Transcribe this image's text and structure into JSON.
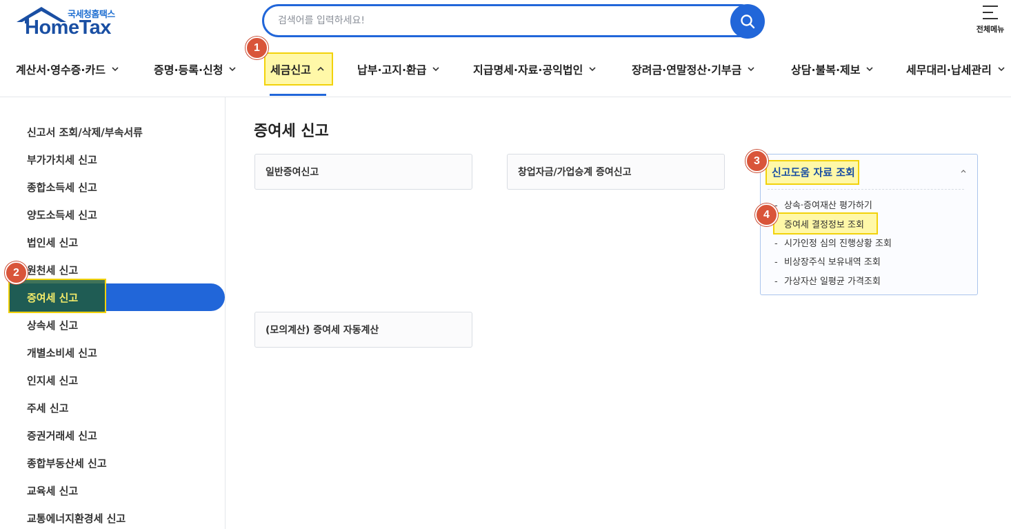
{
  "header": {
    "logo_sub": "국세청홈택스",
    "logo_main": "HomeTax",
    "search_placeholder": "검색어를 입력하세요!",
    "all_menu_label": "전체메뉴"
  },
  "gnb": {
    "items": [
      {
        "label": "계산서·영수증·카드"
      },
      {
        "label": "증명·등록·신청"
      },
      {
        "label": "세금신고"
      },
      {
        "label": "납부·고지·환급"
      },
      {
        "label": "지급명세·자료·공익법인"
      },
      {
        "label": "장려금·연말정산·기부금"
      },
      {
        "label": "상담·불복·제보"
      },
      {
        "label": "세무대리·납세관리"
      }
    ],
    "active_index": 2
  },
  "badges": [
    "1",
    "2",
    "3",
    "4"
  ],
  "sidebar": {
    "items": [
      {
        "label": "신고서 조회/삭제/부속서류"
      },
      {
        "label": "부가가치세 신고"
      },
      {
        "label": "종합소득세 신고"
      },
      {
        "label": "양도소득세 신고"
      },
      {
        "label": "법인세 신고"
      },
      {
        "label": "원천세 신고"
      },
      {
        "label": "증여세 신고"
      },
      {
        "label": "상속세 신고"
      },
      {
        "label": "개별소비세 신고"
      },
      {
        "label": "인지세 신고"
      },
      {
        "label": "주세 신고"
      },
      {
        "label": "증권거래세 신고"
      },
      {
        "label": "종합부동산세 신고"
      },
      {
        "label": "교육세 신고"
      },
      {
        "label": "교통에너지환경세 신고"
      }
    ],
    "active_index": 6
  },
  "main": {
    "title": "증여세 신고",
    "cards": [
      {
        "label": "일반증여신고"
      },
      {
        "label": "창업자금/가업승계 증여신고"
      },
      {
        "label": "(모의계산) 증여세 자동계산"
      }
    ],
    "open_card": {
      "title": "신고도움 자료 조회",
      "items": [
        {
          "label": "상속·증여재산 평가하기"
        },
        {
          "label": "증여세 결정정보 조회"
        },
        {
          "label": "시가인정 심의 진행상황 조회"
        },
        {
          "label": "비상장주식 보유내역 조회"
        },
        {
          "label": "가상자산 일평균 가격조회"
        }
      ]
    }
  },
  "colors": {
    "brand_blue": "#2166d9",
    "highlight_yellow": "#fff8a8",
    "badge_red": "#d9553a"
  }
}
